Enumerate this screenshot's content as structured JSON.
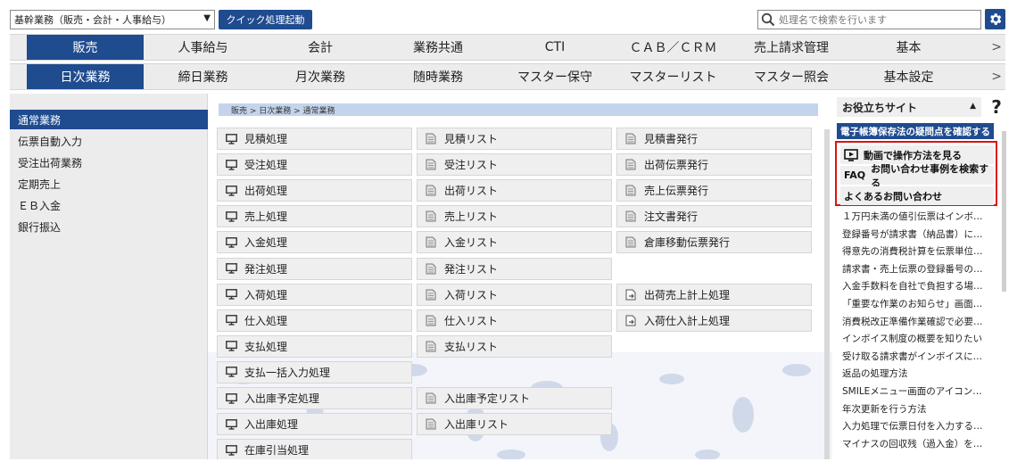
{
  "topbar": {
    "mode_select": "基幹業務（販売・会計・人事給与）",
    "quick_button": "クイック処理起動",
    "search_placeholder": "処理名で検索を行います"
  },
  "nav_row1": {
    "items": [
      "販売",
      "人事給与",
      "会計",
      "業務共通",
      "CTI",
      "ＣＡＢ／ＣＲＭ",
      "売上請求管理",
      "基本"
    ],
    "active_index": 0
  },
  "nav_row2": {
    "items": [
      "日次業務",
      "締日業務",
      "月次業務",
      "随時業務",
      "マスター保守",
      "マスターリスト",
      "マスター照会",
      "基本設定"
    ],
    "active_index": 0
  },
  "sidebar": {
    "items": [
      "通常業務",
      "伝票自動入力",
      "受注出荷業務",
      "定期売上",
      "ＥＢ入金",
      "銀行振込"
    ],
    "active_index": 0
  },
  "breadcrumb": "販売 > 日次業務 > 通常業務",
  "processes": {
    "col1": [
      "見積処理",
      "受注処理",
      "出荷処理",
      "売上処理",
      "入金処理",
      "発注処理",
      "入荷処理",
      "仕入処理",
      "支払処理",
      "支払一括入力処理",
      "入出庫予定処理",
      "入出庫処理",
      "在庫引当処理"
    ],
    "col2": [
      "見積リスト",
      "受注リスト",
      "出荷リスト",
      "売上リスト",
      "入金リスト",
      "発注リスト",
      "入荷リスト",
      "仕入リスト",
      "支払リスト",
      "",
      "入出庫予定リスト",
      "入出庫リスト",
      ""
    ],
    "col3": [
      "見積書発行",
      "出荷伝票発行",
      "売上伝票発行",
      "注文書発行",
      "倉庫移動伝票発行",
      "",
      "出荷売上計上処理",
      "入荷仕入計上処理",
      "",
      "",
      "",
      "",
      ""
    ]
  },
  "right_panel": {
    "header": "お役立ちサイト",
    "help": "?",
    "banner": "電子帳簿保存法の疑問点を確認する",
    "links": [
      {
        "prefix": "",
        "label": "動画で操作方法を見る"
      },
      {
        "prefix": "FAQ",
        "label": "お問い合わせ事例を検索する"
      },
      {
        "prefix": "",
        "label": "よくあるお問い合わせ"
      }
    ],
    "faq": [
      "１万円未満の値引伝票はインボ…",
      "登録番号が請求書（納品書）に…",
      "得意先の消費税計算を伝票単位…",
      "請求書・売上伝票の登録番号の…",
      "入金手数料を自社で負担する場…",
      "「重要な作業のお知らせ」画面…",
      "消費税改正準備作業確認で必要…",
      "インボイス制度の概要を知りたい",
      "受け取る請求書がインボイスに…",
      "返品の処理方法",
      "SMILEメニュー画面のアイコン…",
      "年次更新を行う方法",
      "入力処理で伝票日付を入力する…",
      "マイナスの回収残（過入金）を…"
    ]
  },
  "colors": {
    "brand": "#1f4b8f",
    "nav_bg": "#ececec",
    "highlight_border": "#dd1111",
    "breadcrumb_bg": "#c4d4ec"
  }
}
